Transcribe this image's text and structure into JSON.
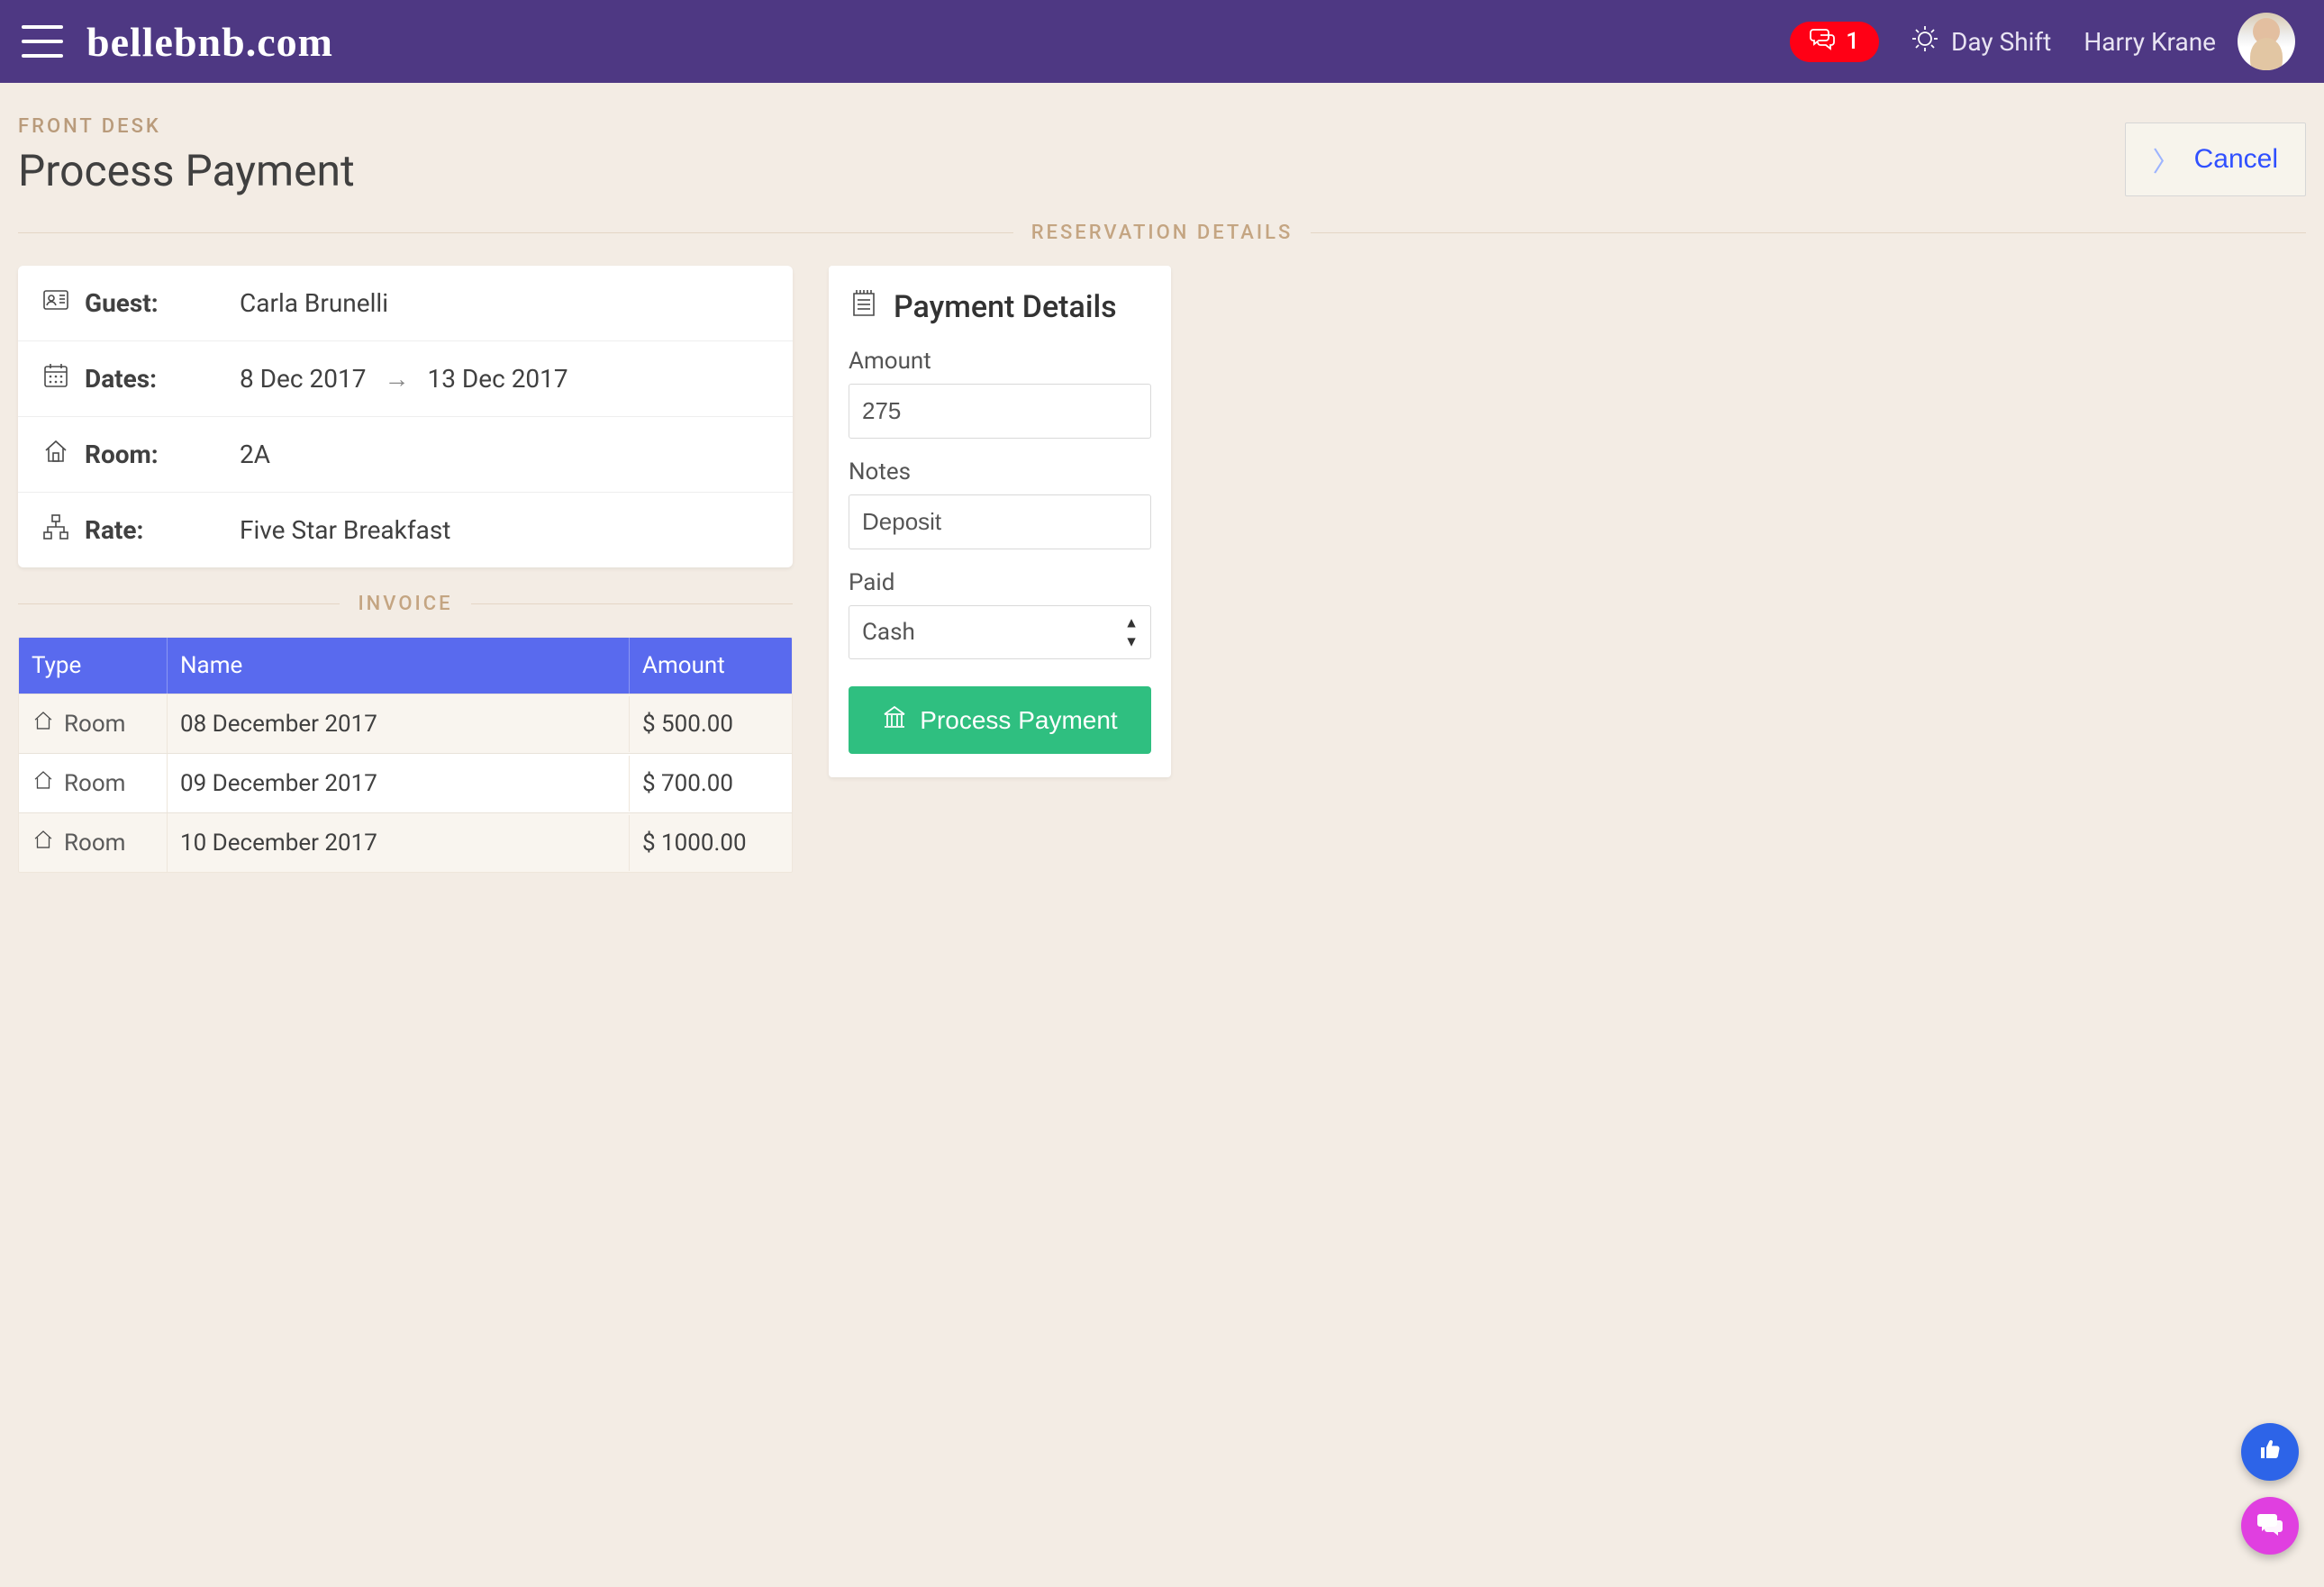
{
  "header": {
    "brand": "bellebnb.com",
    "notif_count": "1",
    "shift_label": "Day Shift",
    "user_name": "Harry Krane"
  },
  "page": {
    "breadcrumb": "FRONT DESK",
    "title": "Process Payment",
    "cancel_label": "Cancel",
    "section_reservation": "RESERVATION DETAILS",
    "section_invoice": "INVOICE"
  },
  "reservation": {
    "guest_label": "Guest:",
    "guest_value": "Carla Brunelli",
    "dates_label": "Dates:",
    "date_from": "8 Dec 2017",
    "date_to": "13 Dec 2017",
    "room_label": "Room:",
    "room_value": "2A",
    "rate_label": "Rate:",
    "rate_value": "Five Star Breakfast"
  },
  "invoice": {
    "col_type": "Type",
    "col_name": "Name",
    "col_amount": "Amount",
    "rows": [
      {
        "type": "Room",
        "name": "08 December 2017",
        "amount": "$ 500.00"
      },
      {
        "type": "Room",
        "name": "09 December 2017",
        "amount": "$ 700.00"
      },
      {
        "type": "Room",
        "name": "10 December 2017",
        "amount": "$ 1000.00"
      }
    ]
  },
  "payment": {
    "panel_title": "Payment Details",
    "amount_label": "Amount",
    "amount_value": "275",
    "notes_label": "Notes",
    "notes_value": "Deposit",
    "paid_label": "Paid",
    "paid_value": "Cash",
    "process_label": "Process Payment"
  }
}
